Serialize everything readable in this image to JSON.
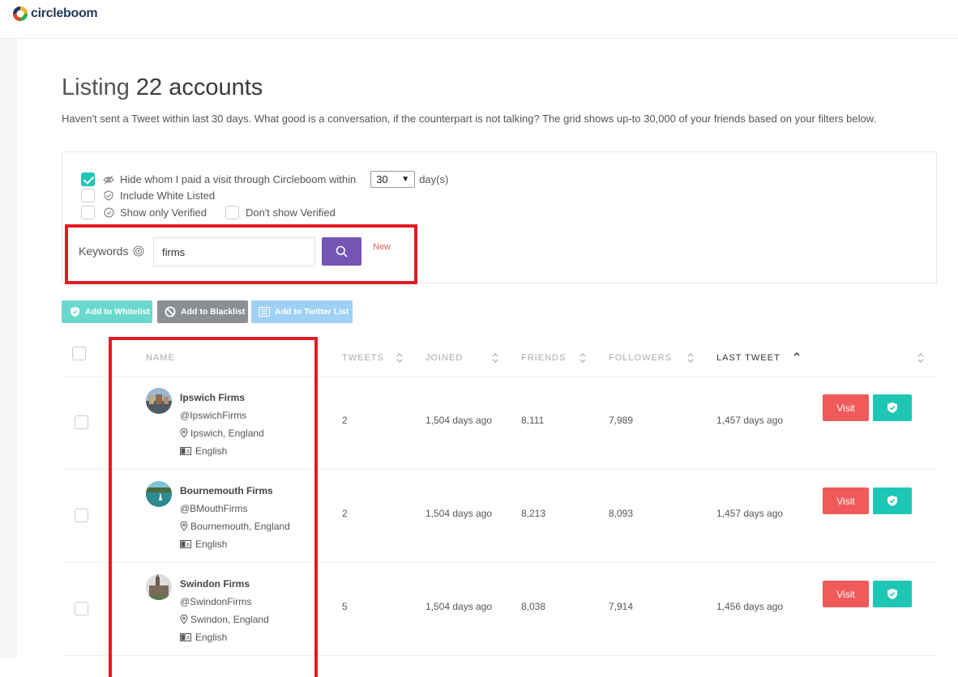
{
  "brand": {
    "name": "circleboom"
  },
  "page": {
    "title_prefix": "Listing",
    "title_count": "22 accounts",
    "subtitle": "Haven't sent a Tweet within last 30 days. What good is a conversation, if the counterpart is not talking? The grid shows up-to 30,000 of your friends based on your filters below."
  },
  "filters": {
    "hide_visited": {
      "label": "Hide whom I paid a visit through Circleboom within",
      "checked": true,
      "days_value": "30",
      "days_unit": "day(s)"
    },
    "include_whitelisted": {
      "label": "Include White Listed",
      "checked": false
    },
    "show_verified": {
      "label": "Show only Verified",
      "checked": false
    },
    "dont_show_verified": {
      "label": "Don't show Verified",
      "checked": false
    },
    "keywords": {
      "label": "Keywords",
      "value": "firms",
      "new_badge": "New"
    }
  },
  "actions": {
    "whitelist": "Add to Whitelist",
    "blacklist": "Add to Blacklist",
    "twitter_list": "Add to Twitter List"
  },
  "table": {
    "headers": {
      "name": "NAME",
      "tweets": "TWEETS",
      "joined": "JOINED",
      "friends": "FRIENDS",
      "followers": "FOLLOWERS",
      "last_tweet": "LAST TWEET"
    },
    "rows": [
      {
        "name": "Ipswich Firms",
        "handle": "@IpswichFirms",
        "location": "Ipswich, England",
        "language": "English",
        "tweets": "2",
        "joined": "1,504 days ago",
        "friends": "8,111",
        "followers": "7,989",
        "last_tweet": "1,457 days ago",
        "visit": "Visit"
      },
      {
        "name": "Bournemouth Firms",
        "handle": "@BMouthFirms",
        "location": "Bournemouth, England",
        "language": "English",
        "tweets": "2",
        "joined": "1,504 days ago",
        "friends": "8,213",
        "followers": "8,093",
        "last_tweet": "1,457 days ago",
        "visit": "Visit"
      },
      {
        "name": "Swindon Firms",
        "handle": "@SwindonFirms",
        "location": "Swindon, England",
        "language": "English",
        "tweets": "5",
        "joined": "1,504 days ago",
        "friends": "8,038",
        "followers": "7,914",
        "last_tweet": "1,456 days ago",
        "visit": "Visit"
      }
    ]
  },
  "colors": {
    "accent_teal": "#1ec6b5",
    "visit_red": "#f05a5a",
    "search_purple": "#7556b5",
    "highlight_red": "#e11b24"
  }
}
